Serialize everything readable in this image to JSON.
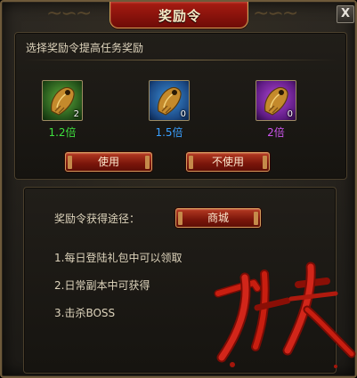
{
  "window": {
    "title": "奖励令",
    "close_label": "X"
  },
  "top": {
    "instruction": "选择奖励令提高任务奖励",
    "items": [
      {
        "count": "2",
        "multiplier": "1.2倍",
        "color": "#3ee03e",
        "rarity": "green"
      },
      {
        "count": "0",
        "multiplier": "1.5倍",
        "color": "#3aa0ff",
        "rarity": "blue"
      },
      {
        "count": "0",
        "multiplier": "2倍",
        "color": "#cc55ee",
        "rarity": "purple"
      }
    ],
    "use_button": "使用",
    "dont_use_button": "不使用"
  },
  "bottom": {
    "source_label": "奖励令获得途径：",
    "shop_button": "商城",
    "sources": [
      "1.每日登陆礼包中可以领取",
      "2.日常副本中可获得",
      "3.击杀BOSS"
    ]
  },
  "colors": {
    "title_red": "#8c1a10",
    "button_red": "#9a2414",
    "text": "#ded4bc",
    "gold_border": "#d2a356"
  },
  "icons": {
    "item": "tiger-tally-icon",
    "close": "close-icon",
    "decoration": "calligraphy-art"
  }
}
